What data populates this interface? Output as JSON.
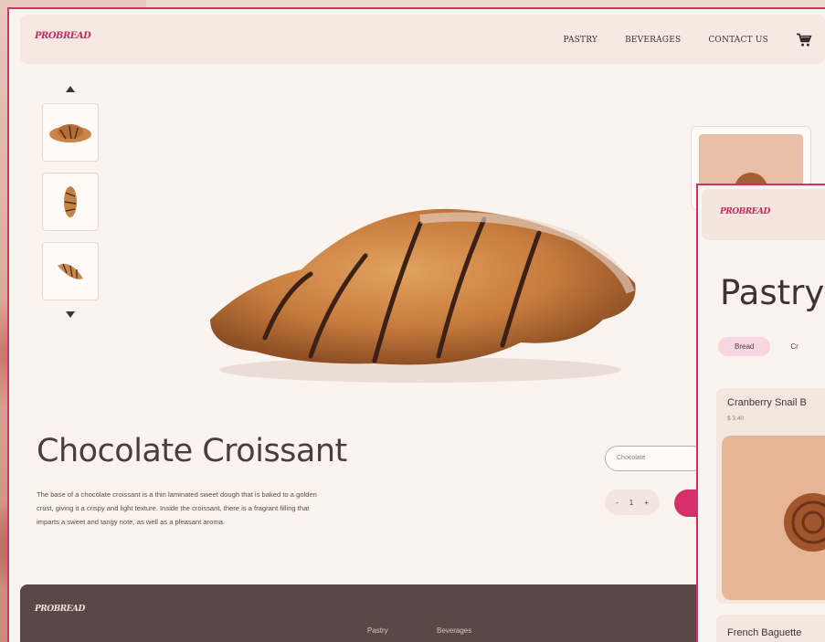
{
  "brand": {
    "logo": "PROBREAD"
  },
  "nav": {
    "links": [
      "PASTRY",
      "BEVERAGES",
      "CONTACT US"
    ],
    "cart_icon": "cart-icon"
  },
  "product": {
    "title": "Chocolate Croissant",
    "description": "The base of a chocolate croissant is a thin laminated sweet dough that is baked to a golden crust, giving it a crispy and light texture. Inside the croissant, there is a fragrant filling that imparts a sweet and tangy note, as well as a pleasant aroma.",
    "flavor_value": "Chocolate",
    "quantity": "1",
    "qty_minus": "-",
    "qty_plus": "+"
  },
  "footer": {
    "logo": "PROBREAD",
    "links": [
      "Pastry",
      "Beverages"
    ]
  },
  "overlay": {
    "logo": "PROBREAD",
    "page_title": "Pastry",
    "tabs": [
      "Bread",
      "Cr"
    ],
    "products": [
      {
        "name": "Cranberry Snail B",
        "price": "$ 3.40"
      },
      {
        "name": "French Baguette",
        "price": ""
      }
    ]
  },
  "colors": {
    "accent": "#d6306a",
    "footer": "#594845",
    "background": "#fbf3ed"
  }
}
